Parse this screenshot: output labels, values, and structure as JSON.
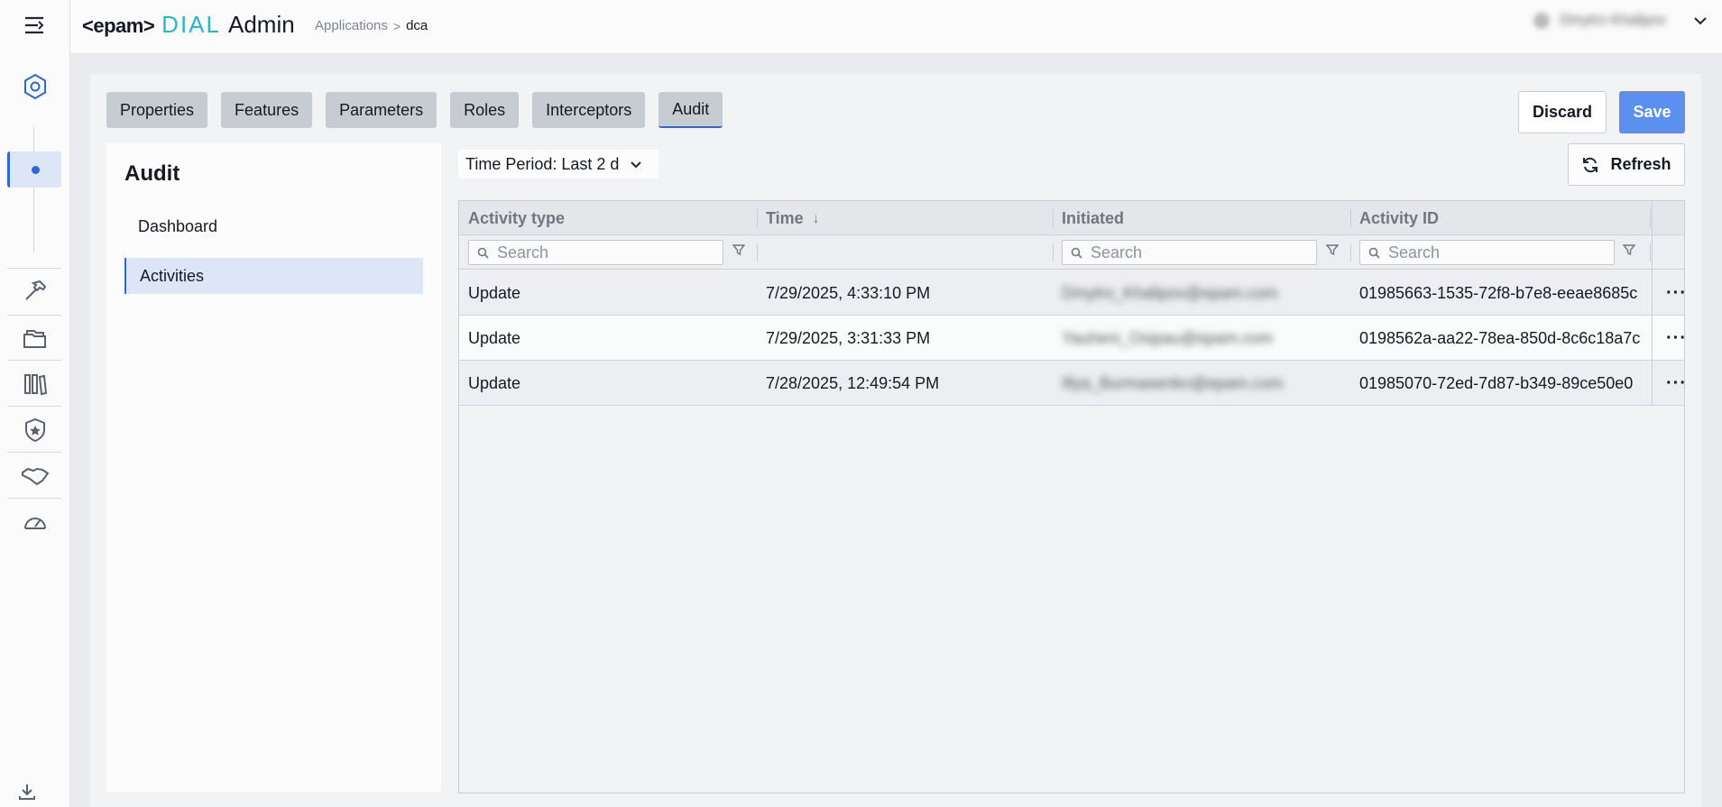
{
  "header": {
    "logo_epam": "<epam>",
    "logo_dial": "DIAL",
    "logo_admin": "Admin",
    "breadcrumb": {
      "parent": "Applications",
      "separator": ">",
      "current": "dca"
    },
    "user_name": "Dmytro Khalipov"
  },
  "tabs": [
    "Properties",
    "Features",
    "Parameters",
    "Roles",
    "Interceptors",
    "Audit"
  ],
  "active_tab": "Audit",
  "actions": {
    "discard": "Discard",
    "save": "Save",
    "refresh": "Refresh"
  },
  "sidebar": {
    "title": "Audit",
    "items": [
      {
        "label": "Dashboard"
      },
      {
        "label": "Activities"
      }
    ],
    "selected": "Activities"
  },
  "filter": {
    "time_period": "Time Period: Last 2 d"
  },
  "grid": {
    "columns": [
      "Activity type",
      "Time",
      "Initiated",
      "Activity ID"
    ],
    "sort_indicator": "↓",
    "search_placeholder": "Search",
    "rows": [
      {
        "activity_type": "Update",
        "time": "7/29/2025, 4:33:10 PM",
        "initiated": "Dmytro_Khalipov@epam.com",
        "activity_id": "01985663-1535-72f8-b7e8-eeae8685c"
      },
      {
        "activity_type": "Update",
        "time": "7/29/2025, 3:31:33 PM",
        "initiated": "Yauheni_Osipau@epam.com",
        "activity_id": "0198562a-aa22-78ea-850d-8c6c18a7c"
      },
      {
        "activity_type": "Update",
        "time": "7/28/2025, 12:49:54 PM",
        "initiated": "Illya_Burmasenko@epam.com",
        "activity_id": "01985070-72ed-7d87-b349-89ce50e0"
      }
    ],
    "row_menu": "···"
  },
  "colors": {
    "accent": "#2d68d6",
    "save_button": "#5b8ff0",
    "tab_bg": "#c7ccd3"
  }
}
